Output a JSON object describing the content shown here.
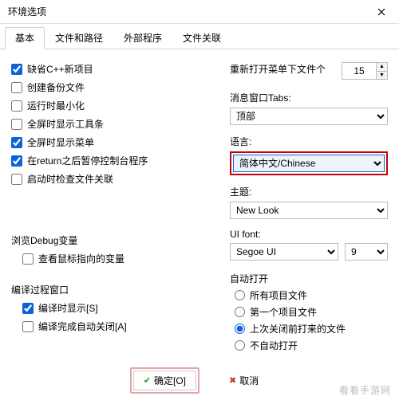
{
  "window": {
    "title": "环境选项"
  },
  "tabs": [
    {
      "label": "基本",
      "active": true
    },
    {
      "label": "文件和路径",
      "active": false
    },
    {
      "label": "外部程序",
      "active": false
    },
    {
      "label": "文件关联",
      "active": false
    }
  ],
  "left": {
    "checks": [
      {
        "label": "缺省C++新项目",
        "checked": true
      },
      {
        "label": "创建备份文件",
        "checked": false
      },
      {
        "label": "运行时最小化",
        "checked": false
      },
      {
        "label": "全屏时显示工具条",
        "checked": false
      },
      {
        "label": "全屏时显示菜单",
        "checked": true
      },
      {
        "label": "在return之后暂停控制台程序",
        "checked": true
      },
      {
        "label": "启动时检查文件关联",
        "checked": false
      }
    ],
    "debug_group": "浏览Debug变量",
    "debug_check": {
      "label": "查看鼠标指向的变量",
      "checked": false
    },
    "compile_group": "编译过程窗口",
    "compile_checks": [
      {
        "label": "编译时显示[S]",
        "checked": true
      },
      {
        "label": "编译完成自动关闭[A]",
        "checked": false
      }
    ]
  },
  "right": {
    "reopen_label": "重新打开菜单下文件个",
    "reopen_value": "15",
    "tabs_label": "消息窗口Tabs:",
    "tabs_value": "顶部",
    "lang_label": "语言:",
    "lang_value": "简体中文/Chinese",
    "theme_label": "主题:",
    "theme_value": "New Look",
    "uifont_label": "UI font:",
    "uifont_value": "Segoe UI",
    "uifont_size": "9",
    "auto_open_label": "自动打开",
    "radios": [
      {
        "label": "所有项目文件",
        "checked": false
      },
      {
        "label": "第一个项目文件",
        "checked": false
      },
      {
        "label": "上次关闭前打来的文件",
        "checked": true
      },
      {
        "label": "不自动打开",
        "checked": false
      }
    ]
  },
  "footer": {
    "ok": "确定[O]",
    "cancel": "取消",
    "help_partial": "✱"
  },
  "watermark": "看看手游网"
}
